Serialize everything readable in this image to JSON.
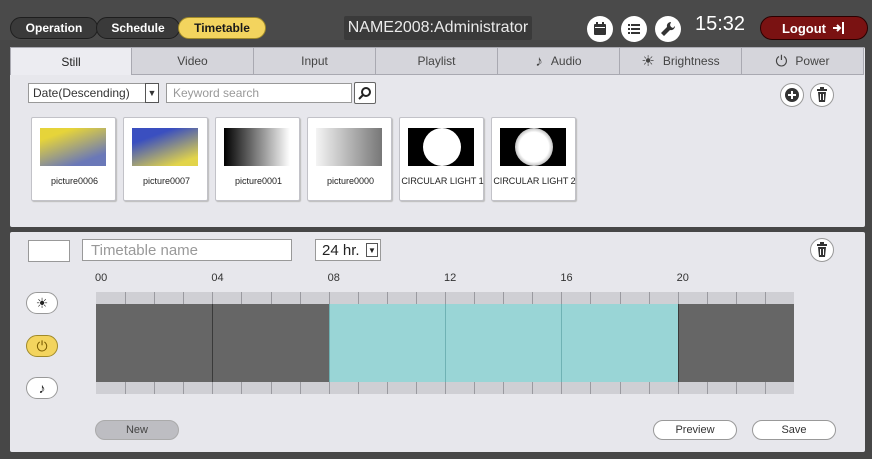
{
  "header": {
    "modes": [
      {
        "label": "Operation",
        "active": false
      },
      {
        "label": "Schedule",
        "active": false
      },
      {
        "label": "Timetable",
        "active": true
      }
    ],
    "title": "NAME2008:Administrator",
    "icons": [
      "calendar-icon",
      "list-icon",
      "wrench-icon"
    ],
    "time": "15:32",
    "logout_label": "Logout"
  },
  "tabs": [
    {
      "label": "Still",
      "icon": "",
      "active": true
    },
    {
      "label": "Video",
      "icon": "",
      "active": false
    },
    {
      "label": "Input",
      "icon": "",
      "active": false
    },
    {
      "label": "Playlist",
      "icon": "",
      "active": false
    },
    {
      "label": "Audio",
      "icon": "music-note-icon",
      "glyph": "♪",
      "active": false
    },
    {
      "label": "Brightness",
      "icon": "sun-icon",
      "glyph": "☀",
      "active": false
    },
    {
      "label": "Power",
      "icon": "power-icon",
      "glyph": "⏻",
      "active": false
    }
  ],
  "filter": {
    "sort_value": "Date(Descending)",
    "keyword_placeholder": "Keyword search"
  },
  "media": [
    {
      "name": "picture0006",
      "thumbnail": "yellow-blue gradient"
    },
    {
      "name": "picture0007",
      "thumbnail": "blue-yellow gradient"
    },
    {
      "name": "picture0001",
      "thumbnail": "black-white gradient"
    },
    {
      "name": "picture0000",
      "thumbnail": "gray gradient"
    },
    {
      "name": "CIRCULAR LIGHT 1",
      "thumbnail": "white circle"
    },
    {
      "name": "CIRCULAR LIGHT 2",
      "thumbnail": "soft white circle"
    }
  ],
  "timetable": {
    "name_placeholder": "Timetable name",
    "hours_value": "24 hr.",
    "hour_labels": [
      "00",
      "04",
      "08",
      "12",
      "16",
      "20"
    ],
    "segments": [
      {
        "from": 0,
        "to": 8,
        "state": "off"
      },
      {
        "from": 8,
        "to": 20,
        "state": "on"
      },
      {
        "from": 20,
        "to": 24,
        "state": "off"
      }
    ],
    "colors": {
      "off": "#666666",
      "on": "#99d5d6",
      "active": "#f3d45e"
    },
    "side_buttons": [
      {
        "icon": "sun-icon",
        "glyph": "☀",
        "active": false
      },
      {
        "icon": "power-icon",
        "glyph": "⏻",
        "active": true
      },
      {
        "icon": "music-note-icon",
        "glyph": "♪",
        "active": false
      }
    ]
  },
  "buttons": {
    "new_label": "New",
    "preview_label": "Preview",
    "save_label": "Save"
  }
}
